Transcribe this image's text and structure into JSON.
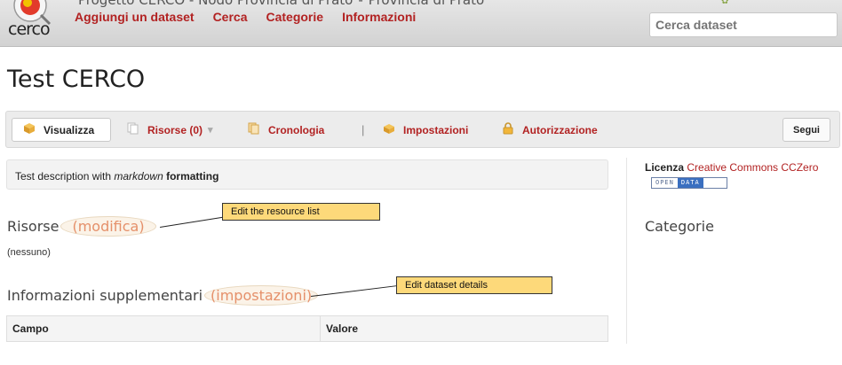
{
  "header": {
    "site_title_part1": "Progetto CERCO - Nodo Provincia di Prato",
    "site_title_sep": "-",
    "site_title_part2": "Provincia di Prato",
    "logo_text": "cerco",
    "nav": [
      "Aggiungi un dataset",
      "Cerca",
      "Categorie",
      "Informazioni"
    ],
    "search_placeholder": "Cerca dataset"
  },
  "page": {
    "title": "Test CERCO"
  },
  "toolbar": {
    "tabs": [
      {
        "label": "Visualizza",
        "icon": "package-icon"
      },
      {
        "label": "Risorse (0)",
        "icon": "documents-icon"
      },
      {
        "label": "Cronologia",
        "icon": "history-icon"
      },
      {
        "label": "Impostazioni",
        "icon": "settings-package-icon"
      },
      {
        "label": "Autorizzazione",
        "icon": "lock-icon"
      }
    ],
    "separator": "|",
    "follow_label": "Segui"
  },
  "description": {
    "prefix": "Test description with ",
    "emphasis": "markdown",
    "bold": "formatting"
  },
  "resources": {
    "title": "Risorse",
    "edit_link": "(modifica)",
    "empty_text": "(nessuno)",
    "tooltip": "Edit the resource list"
  },
  "additional": {
    "title": "Informazioni supplementari",
    "edit_link": "(impostazioni)",
    "tooltip": "Edit dataset details",
    "columns": [
      "Campo",
      "Valore"
    ]
  },
  "sidebar": {
    "license_label": "Licenza",
    "license_value": "Creative Commons CCZero",
    "open_data_left": "OPEN",
    "open_data_right": "DATA",
    "categories_title": "Categorie"
  },
  "colors": {
    "accent": "#b22222",
    "tooltip_bg": "#fdd97a",
    "edit_link": "#e5906a"
  }
}
